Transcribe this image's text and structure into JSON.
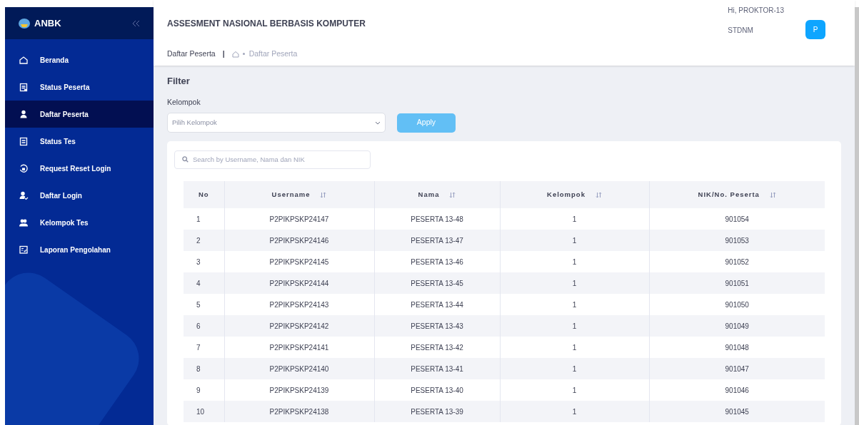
{
  "sidebar": {
    "brand": "ANBK",
    "items": [
      {
        "label": "Beranda",
        "selected": false
      },
      {
        "label": "Status Peserta",
        "selected": false
      },
      {
        "label": "Daftar Peserta",
        "selected": true
      },
      {
        "label": "Status Tes",
        "selected": false
      },
      {
        "label": "Request Reset Login",
        "selected": false
      },
      {
        "label": "Daftar Login",
        "selected": false
      },
      {
        "label": "Kelompok Tes",
        "selected": false
      },
      {
        "label": "Laporan Pengolahan",
        "selected": false
      }
    ]
  },
  "header": {
    "title": "ASSESMENT NASIONAL BERBASIS KOMPUTER",
    "greeting": "Hi, PROKTOR-13",
    "school": "STDNM",
    "avatar": "P"
  },
  "breadcrumb": {
    "page": "Daftar Peserta",
    "separator": "|",
    "current": "Daftar Peserta"
  },
  "filter": {
    "title": "Filter",
    "label": "Kelompok",
    "select": {
      "placeholder": "Pilih Kelompok"
    },
    "button": "Apply"
  },
  "search": {
    "placeholder": "Search by Username, Nama dan NIK"
  },
  "table": {
    "columns": [
      {
        "label": "No",
        "sortable": false
      },
      {
        "label": "Username",
        "sortable": true
      },
      {
        "label": "Nama",
        "sortable": true
      },
      {
        "label": "Kelompok",
        "sortable": true
      },
      {
        "label": "NIK/No. Peserta",
        "sortable": true
      }
    ],
    "rows": [
      [
        "1",
        "P2PIKPSKP24147",
        "PESERTA 13-48",
        "1",
        "901054"
      ],
      [
        "2",
        "P2PIKPSKP24146",
        "PESERTA 13-47",
        "1",
        "901053"
      ],
      [
        "3",
        "P2PIKPSKP24145",
        "PESERTA 13-46",
        "1",
        "901052"
      ],
      [
        "4",
        "P2PIKPSKP24144",
        "PESERTA 13-45",
        "1",
        "901051"
      ],
      [
        "5",
        "P2PIKPSKP24143",
        "PESERTA 13-44",
        "1",
        "901050"
      ],
      [
        "6",
        "P2PIKPSKP24142",
        "PESERTA 13-43",
        "1",
        "901049"
      ],
      [
        "7",
        "P2PIKPSKP24141",
        "PESERTA 13-42",
        "1",
        "901048"
      ],
      [
        "8",
        "P2PIKPSKP24140",
        "PESERTA 13-41",
        "1",
        "901047"
      ],
      [
        "9",
        "P2PIKPSKP24139",
        "PESERTA 13-40",
        "1",
        "901046"
      ],
      [
        "10",
        "P2PIKPSKP24138",
        "PESERTA 13-39",
        "1",
        "901045"
      ]
    ]
  }
}
